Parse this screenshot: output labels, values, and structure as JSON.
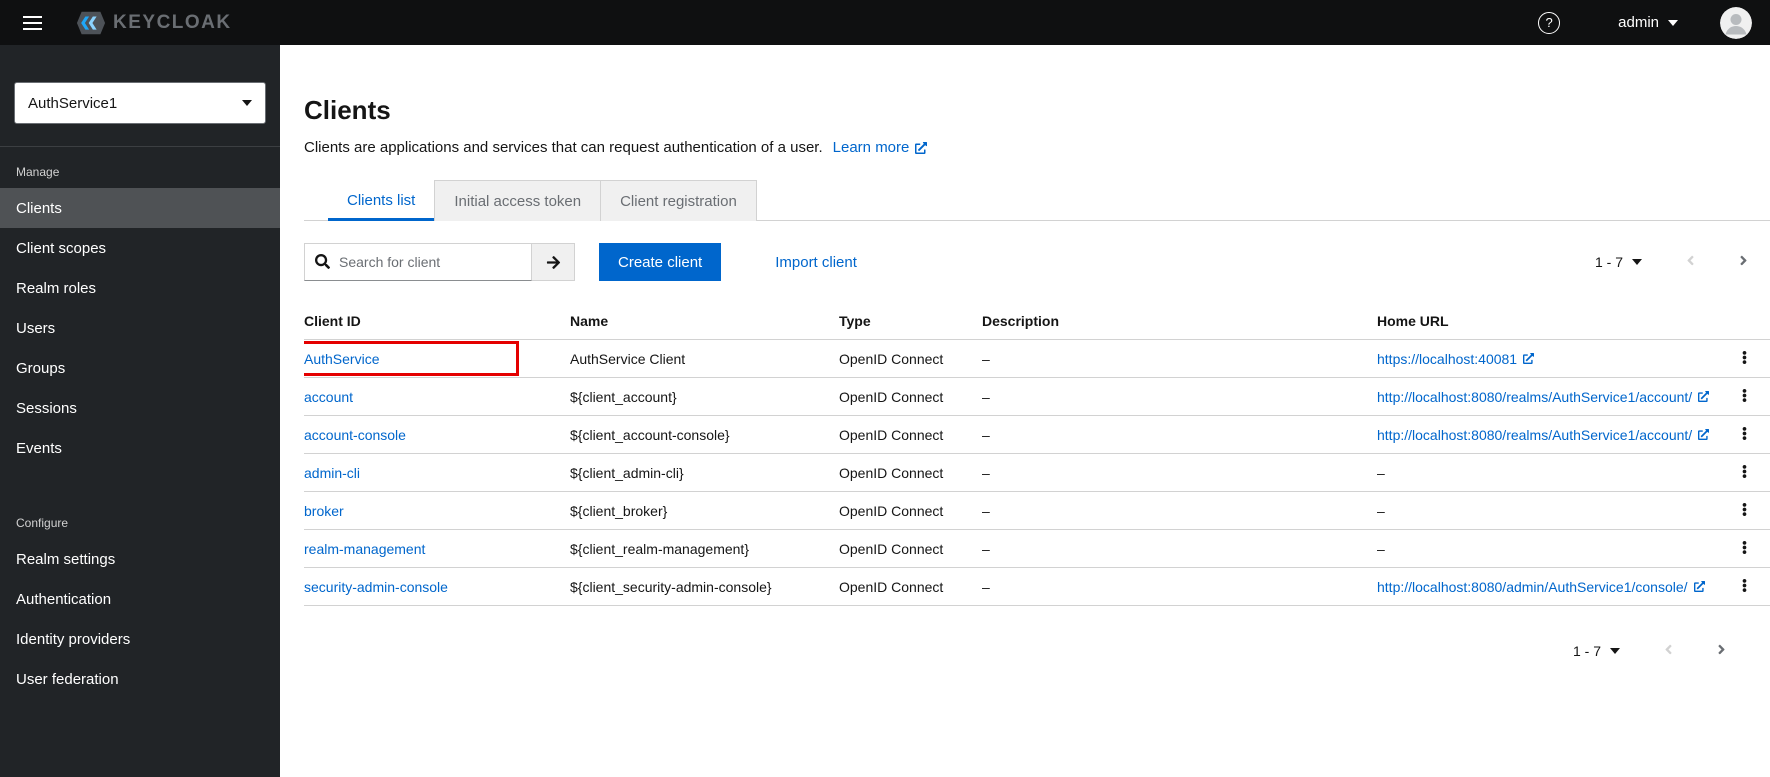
{
  "colors": {
    "accent": "#0066cc",
    "masthead_bg": "#0f1011",
    "sidebar_bg": "#212427",
    "sidebar_active_bg": "#4f5255",
    "primary_button_bg": "#0066cc",
    "link": "#0066cc",
    "tab_inactive_bg": "#f0f0f0",
    "border": "#d2d2d2",
    "text": "#151515",
    "muted_text": "#6a6e73",
    "highlight_box": "#e40000"
  },
  "header": {
    "brand": "KEYCLOAK",
    "user": "admin"
  },
  "icons": {
    "hamburger": "three-bars",
    "help": "?",
    "caret_down": "triangle-down",
    "avatar": "person-circle",
    "search": "magnifier",
    "submit_arrow": "arrow-right",
    "external_link": "external-link",
    "chevron_left": "angle-left",
    "chevron_right": "angle-right",
    "kebab": "vertical-dots"
  },
  "sidebar": {
    "realm": "AuthService1",
    "sections": [
      {
        "label": "Manage",
        "items": [
          {
            "label": "Clients",
            "active": true
          },
          {
            "label": "Client scopes",
            "active": false
          },
          {
            "label": "Realm roles",
            "active": false
          },
          {
            "label": "Users",
            "active": false
          },
          {
            "label": "Groups",
            "active": false
          },
          {
            "label": "Sessions",
            "active": false
          },
          {
            "label": "Events",
            "active": false
          }
        ]
      },
      {
        "label": "Configure",
        "items": [
          {
            "label": "Realm settings",
            "active": false
          },
          {
            "label": "Authentication",
            "active": false
          },
          {
            "label": "Identity providers",
            "active": false
          },
          {
            "label": "User federation",
            "active": false
          }
        ]
      }
    ]
  },
  "main": {
    "title": "Clients",
    "subtitle": "Clients are applications and services that can request authentication of a user.",
    "learn_more_label": "Learn more",
    "tabs": [
      {
        "label": "Clients list",
        "active": true
      },
      {
        "label": "Initial access token",
        "active": false
      },
      {
        "label": "Client registration",
        "active": false
      }
    ],
    "toolbar": {
      "search_placeholder": "Search for client",
      "create_button_label": "Create client",
      "import_link_label": "Import client",
      "pagination_range": "1 - 7"
    },
    "table": {
      "columns": [
        "Client ID",
        "Name",
        "Type",
        "Description",
        "Home URL"
      ],
      "rows": [
        {
          "client_id": "AuthService",
          "name": "AuthService Client",
          "type": "OpenID Connect",
          "description": "–",
          "home_url": "https://localhost:40081",
          "home_external": true,
          "highlighted": true
        },
        {
          "client_id": "account",
          "name": "${client_account}",
          "type": "OpenID Connect",
          "description": "–",
          "home_url": "http://localhost:8080/realms/AuthService1/account/",
          "home_external": true,
          "highlighted": false
        },
        {
          "client_id": "account-console",
          "name": "${client_account-console}",
          "type": "OpenID Connect",
          "description": "–",
          "home_url": "http://localhost:8080/realms/AuthService1/account/",
          "home_external": true,
          "highlighted": false
        },
        {
          "client_id": "admin-cli",
          "name": "${client_admin-cli}",
          "type": "OpenID Connect",
          "description": "–",
          "home_url": "–",
          "home_external": false,
          "highlighted": false
        },
        {
          "client_id": "broker",
          "name": "${client_broker}",
          "type": "OpenID Connect",
          "description": "–",
          "home_url": "–",
          "home_external": false,
          "highlighted": false
        },
        {
          "client_id": "realm-management",
          "name": "${client_realm-management}",
          "type": "OpenID Connect",
          "description": "–",
          "home_url": "–",
          "home_external": false,
          "highlighted": false
        },
        {
          "client_id": "security-admin-console",
          "name": "${client_security-admin-console}",
          "type": "OpenID Connect",
          "description": "–",
          "home_url": "http://localhost:8080/admin/AuthService1/console/",
          "home_external": true,
          "highlighted": false
        }
      ]
    },
    "footer": {
      "pagination_range": "1 - 7"
    }
  }
}
